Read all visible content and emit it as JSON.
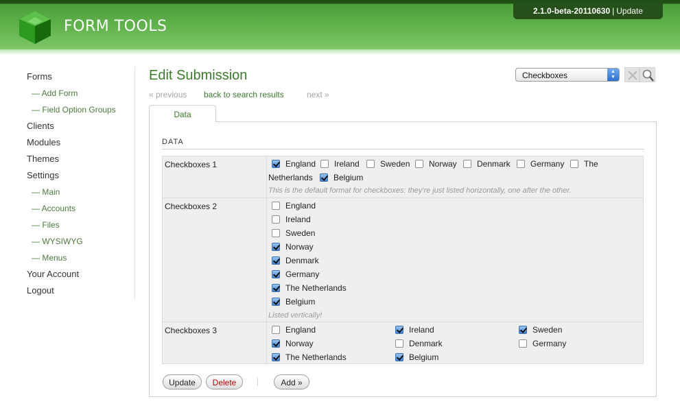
{
  "header": {
    "logo_text": "FORM TOOLS",
    "version": "2.1.0-beta-20110630",
    "separator": "|",
    "update_link": "Update"
  },
  "sidebar": {
    "items": [
      {
        "label": "Forms"
      },
      {
        "label": "— Add Form"
      },
      {
        "label": "— Field Option Groups"
      },
      {
        "label": "Clients"
      },
      {
        "label": "Modules"
      },
      {
        "label": "Themes"
      },
      {
        "label": "Settings"
      },
      {
        "label": "— Main"
      },
      {
        "label": "— Accounts"
      },
      {
        "label": "— Files"
      },
      {
        "label": "— WYSIWYG"
      },
      {
        "label": "— Menus"
      },
      {
        "label": "Your Account"
      },
      {
        "label": "Logout"
      }
    ]
  },
  "main": {
    "title": "Edit Submission",
    "view_select": {
      "value": "Checkboxes"
    },
    "nav": {
      "previous": "« previous",
      "back": "back to search results",
      "next": "next »"
    },
    "tab": "Data",
    "section_title": "DATA",
    "fields": [
      {
        "label": "Checkboxes 1",
        "options": [
          {
            "label": "England",
            "checked": true
          },
          {
            "label": "Ireland",
            "checked": false
          },
          {
            "label": "Sweden",
            "checked": false
          },
          {
            "label": "Norway",
            "checked": false
          },
          {
            "label": "Denmark",
            "checked": false
          },
          {
            "label": "Germany",
            "checked": false
          },
          {
            "label": "The",
            "checked": false
          },
          {
            "label": "Netherlands",
            "checked": null
          },
          {
            "label": "Belgium",
            "checked": true
          }
        ],
        "note": "This is the default format for checkboxes: they're just listed horizontally, one after the other."
      },
      {
        "label": "Checkboxes 2",
        "options": [
          {
            "label": "England",
            "checked": false
          },
          {
            "label": "Ireland",
            "checked": false
          },
          {
            "label": "Sweden",
            "checked": false
          },
          {
            "label": "Norway",
            "checked": true
          },
          {
            "label": "Denmark",
            "checked": true
          },
          {
            "label": "Germany",
            "checked": true
          },
          {
            "label": "The Netherlands",
            "checked": true
          },
          {
            "label": "Belgium",
            "checked": true
          }
        ],
        "note": "Listed vertically!"
      },
      {
        "label": "Checkboxes 3",
        "options": [
          {
            "label": "England",
            "checked": false
          },
          {
            "label": "Ireland",
            "checked": true
          },
          {
            "label": "Sweden",
            "checked": true
          },
          {
            "label": "Norway",
            "checked": true
          },
          {
            "label": "Denmark",
            "checked": false
          },
          {
            "label": "Germany",
            "checked": false
          },
          {
            "label": "The Netherlands",
            "checked": true
          },
          {
            "label": "Belgium",
            "checked": true
          }
        ]
      }
    ],
    "buttons": {
      "update": "Update",
      "delete": "Delete",
      "add": "Add »"
    }
  },
  "colors": {
    "brand_green": "#3a7b2c",
    "header_dark": "#25501a",
    "delete_red": "#c00000"
  }
}
